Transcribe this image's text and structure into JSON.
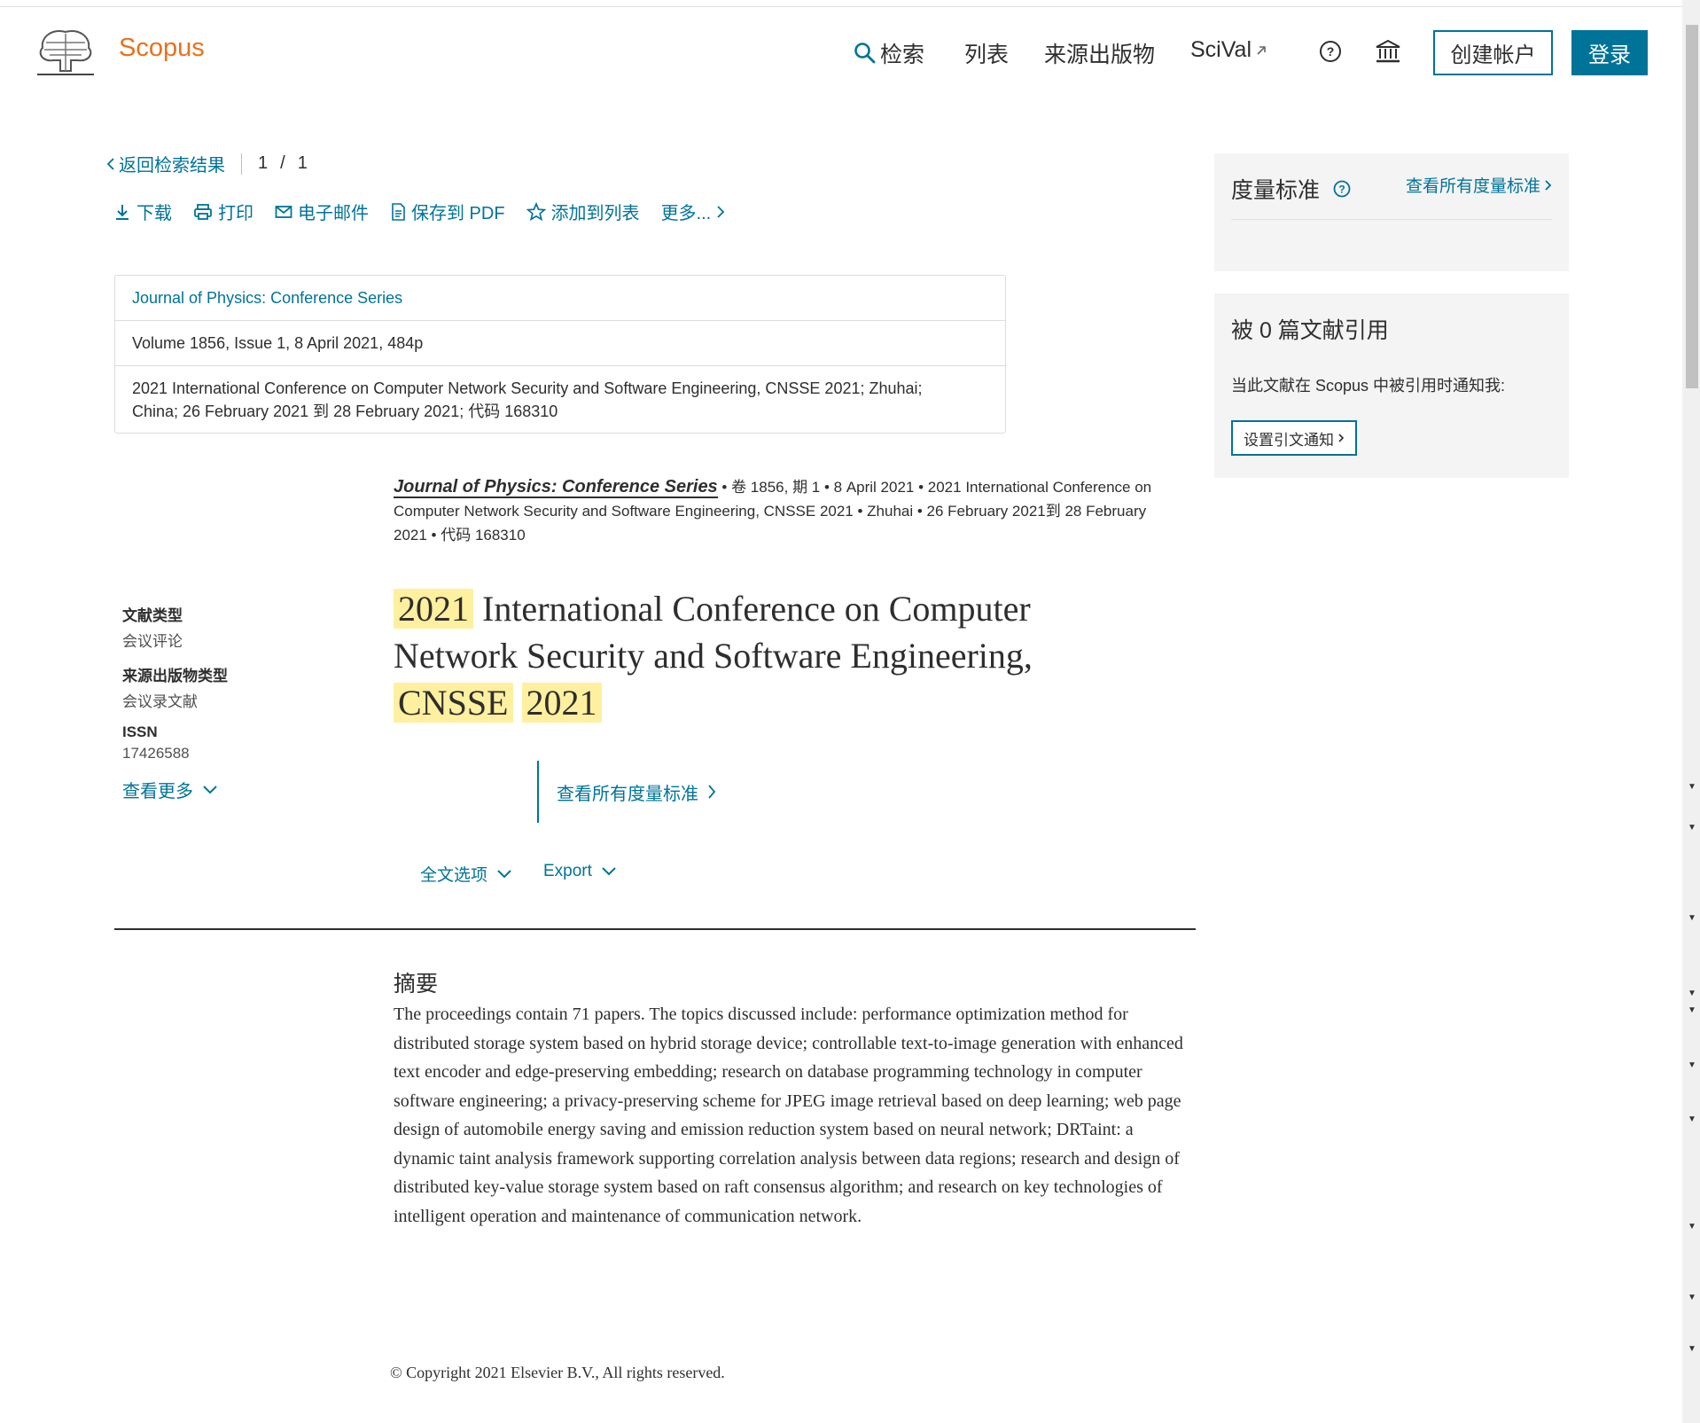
{
  "header": {
    "brand": "Scopus",
    "nav": {
      "search": "检索",
      "lists": "列表",
      "sources": "来源出版物",
      "scival": "SciVal"
    },
    "create_account": "创建帐户",
    "login": "登录"
  },
  "breadcrumb": {
    "back": "返回检索结果",
    "page": "1",
    "slash": "/",
    "total": "1"
  },
  "actions": {
    "download": "下载",
    "print": "打印",
    "email": "电子邮件",
    "save_pdf": "保存到 PDF",
    "add_list": "添加到列表",
    "more": "更多..."
  },
  "source_box": {
    "journal": "Journal of Physics: Conference Series",
    "volume": "Volume 1856, Issue 1, 8 April 2021, 484p",
    "conference_line1": "2021 International Conference on Computer Network Security and Software Engineering, CNSSE 2021; Zhuhai;",
    "conference_line2": "China; 26 February 2021 到 28 February 2021; 代码 168310"
  },
  "citation": {
    "journal": "Journal of Physics: Conference Series",
    "rest": " • 卷 1856, 期 1 • 8 April 2021 • 2021 International Conference on Computer Network Security and Software Engineering, CNSSE 2021 • Zhuhai • 26 February 2021到 28 February 2021 • 代码 168310"
  },
  "meta": {
    "doc_type_label": "文献类型",
    "doc_type_value": "会议评论",
    "source_type_label": "来源出版物类型",
    "source_type_value": "会议录文献",
    "issn_label": "ISSN",
    "issn_value": "17426588",
    "view_more": "查看更多"
  },
  "title": {
    "hl1": "2021",
    "middle": " International Conference on Computer Network Security and Software Engineering, ",
    "hl2": "CNSSE",
    "hl3": "2021"
  },
  "view_all_metrics": "查看所有度量标准",
  "fulltext_options": "全文选项",
  "export": "Export",
  "abstract": {
    "heading": "摘要",
    "text": "The proceedings contain 71 papers. The topics discussed include: performance optimization method for distributed storage system based on hybrid storage device; controllable text-to-image generation with enhanced text encoder and edge-preserving embedding; research on database programming technology in computer software engineering; a privacy-preserving scheme for JPEG image retrieval based on deep learning; web page design of automobile energy saving and emission reduction system based on neural network; DRTaint: a dynamic taint analysis framework supporting correlation analysis between data regions; research and design of distributed key-value storage system based on raft consensus algorithm; and research on key technologies of intelligent operation and maintenance of communication network."
  },
  "copyright": "© Copyright 2021 Elsevier B.V., All rights reserved.",
  "metrics_panel": {
    "title": "度量标准",
    "link": "查看所有度量标准"
  },
  "cited_panel": {
    "title": "被 0 篇文献引用",
    "text": "当此文献在 Scopus 中被引用时通知我:",
    "button": "设置引文通知"
  },
  "colors": {
    "accent": "#007398",
    "brand": "#e9711c",
    "highlight": "#fff0a0"
  }
}
